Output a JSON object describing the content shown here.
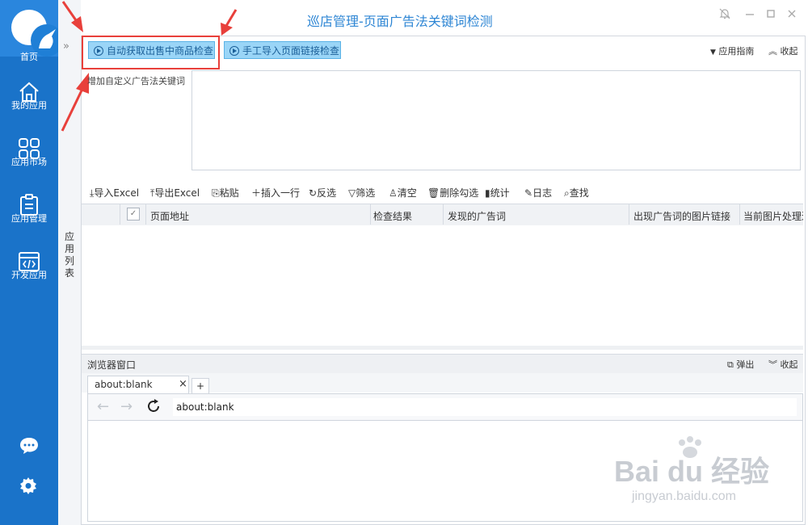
{
  "window": {
    "title": "巡店管理-页面广告法关键词检测"
  },
  "nav": {
    "home": "首页",
    "items": [
      {
        "label": "我的应用",
        "icon": "home-icon"
      },
      {
        "label": "应用市场",
        "icon": "grid-icon"
      },
      {
        "label": "应用管理",
        "icon": "clipboard-icon"
      },
      {
        "label": "开发应用",
        "icon": "code-window-icon"
      }
    ],
    "bottom_icons": [
      "chat-icon",
      "settings-gear-icon"
    ]
  },
  "sidebar2": {
    "expand": "»",
    "vertical_label": "应用列表"
  },
  "actions": {
    "auto_check": "自动获取出售中商品检查",
    "manual_check": "手工导入页面链接检查",
    "guide": "应用指南",
    "collapse": "收起"
  },
  "keywords": {
    "label": "增加自定义广告法关键词",
    "value": ""
  },
  "toolbar": {
    "import_excel": "导入Excel",
    "export_excel": "导出Excel",
    "paste": "粘贴",
    "insert_row": "插入一行",
    "invert": "反选",
    "filter": "筛选",
    "clear": "清空",
    "delete_checked": "删除勾选",
    "stats": "统计",
    "log": "日志",
    "find": "查找"
  },
  "grid": {
    "columns": [
      "页面地址",
      "检查结果",
      "发现的广告词",
      "出现广告词的图片链接",
      "当前图片处理进"
    ],
    "rows": []
  },
  "browser": {
    "title": "浏览器窗口",
    "popout": "弹出",
    "collapse": "收起",
    "tab_label": "about:blank",
    "tab_close": "×",
    "new_tab": "+",
    "url": "about:blank"
  },
  "watermark": {
    "brand": "Bai du 经验",
    "url": "jingyan.baidu.com"
  },
  "colors": {
    "nav_blue": "#1a73c9",
    "title_blue": "#2e86d4",
    "button_fill": "#9ad5f7",
    "highlight_red": "#e8403b"
  }
}
